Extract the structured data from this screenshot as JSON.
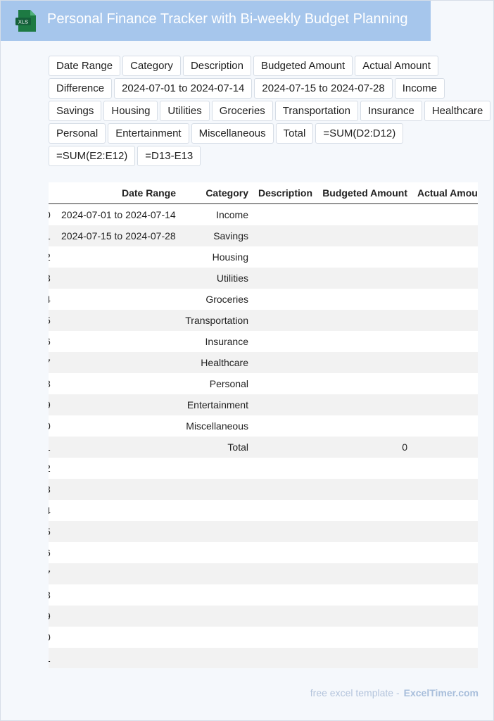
{
  "header": {
    "title": "Personal Finance Tracker with Bi-weekly Budget Planning",
    "icon_label": "XLS",
    "icon_color": "#1d7a43"
  },
  "chips": [
    "Date Range",
    "Category",
    "Description",
    "Budgeted Amount",
    "Actual Amount",
    "Difference",
    "2024-07-01 to 2024-07-14",
    "2024-07-15 to 2024-07-28",
    "Income",
    "Savings",
    "Housing",
    "Utilities",
    "Groceries",
    "Transportation",
    "Insurance",
    "Healthcare",
    "Personal",
    "Entertainment",
    "Miscellaneous",
    "Total",
    "=SUM(D2:D12)",
    "=SUM(E2:E12)",
    "=D13-E13"
  ],
  "table": {
    "columns": [
      "Date Range",
      "Category",
      "Description",
      "Budgeted Amount",
      "Actual Amou"
    ],
    "rows": [
      {
        "index": "0",
        "date": "2024-07-01 to 2024-07-14",
        "category": "Income",
        "budgeted": ""
      },
      {
        "index": "1",
        "date": "2024-07-15 to 2024-07-28",
        "category": "Savings",
        "budgeted": ""
      },
      {
        "index": "2",
        "date": "",
        "category": "Housing",
        "budgeted": ""
      },
      {
        "index": "3",
        "date": "",
        "category": "Utilities",
        "budgeted": ""
      },
      {
        "index": "4",
        "date": "",
        "category": "Groceries",
        "budgeted": ""
      },
      {
        "index": "5",
        "date": "",
        "category": "Transportation",
        "budgeted": ""
      },
      {
        "index": "6",
        "date": "",
        "category": "Insurance",
        "budgeted": ""
      },
      {
        "index": "7",
        "date": "",
        "category": "Healthcare",
        "budgeted": ""
      },
      {
        "index": "8",
        "date": "",
        "category": "Personal",
        "budgeted": ""
      },
      {
        "index": "9",
        "date": "",
        "category": "Entertainment",
        "budgeted": ""
      },
      {
        "index": "0",
        "date": "",
        "category": "Miscellaneous",
        "budgeted": ""
      },
      {
        "index": "1",
        "date": "",
        "category": "Total",
        "budgeted": "0"
      },
      {
        "index": "2",
        "date": "",
        "category": "",
        "budgeted": ""
      },
      {
        "index": "3",
        "date": "",
        "category": "",
        "budgeted": ""
      },
      {
        "index": "4",
        "date": "",
        "category": "",
        "budgeted": ""
      },
      {
        "index": "5",
        "date": "",
        "category": "",
        "budgeted": ""
      },
      {
        "index": "6",
        "date": "",
        "category": "",
        "budgeted": ""
      },
      {
        "index": "7",
        "date": "",
        "category": "",
        "budgeted": ""
      },
      {
        "index": "8",
        "date": "",
        "category": "",
        "budgeted": ""
      },
      {
        "index": "9",
        "date": "",
        "category": "",
        "budgeted": ""
      },
      {
        "index": "0",
        "date": "",
        "category": "",
        "budgeted": ""
      },
      {
        "index": "1",
        "date": "",
        "category": "",
        "budgeted": ""
      }
    ]
  },
  "footer": {
    "text": "free excel template -",
    "brand": "ExcelTimer.com"
  }
}
